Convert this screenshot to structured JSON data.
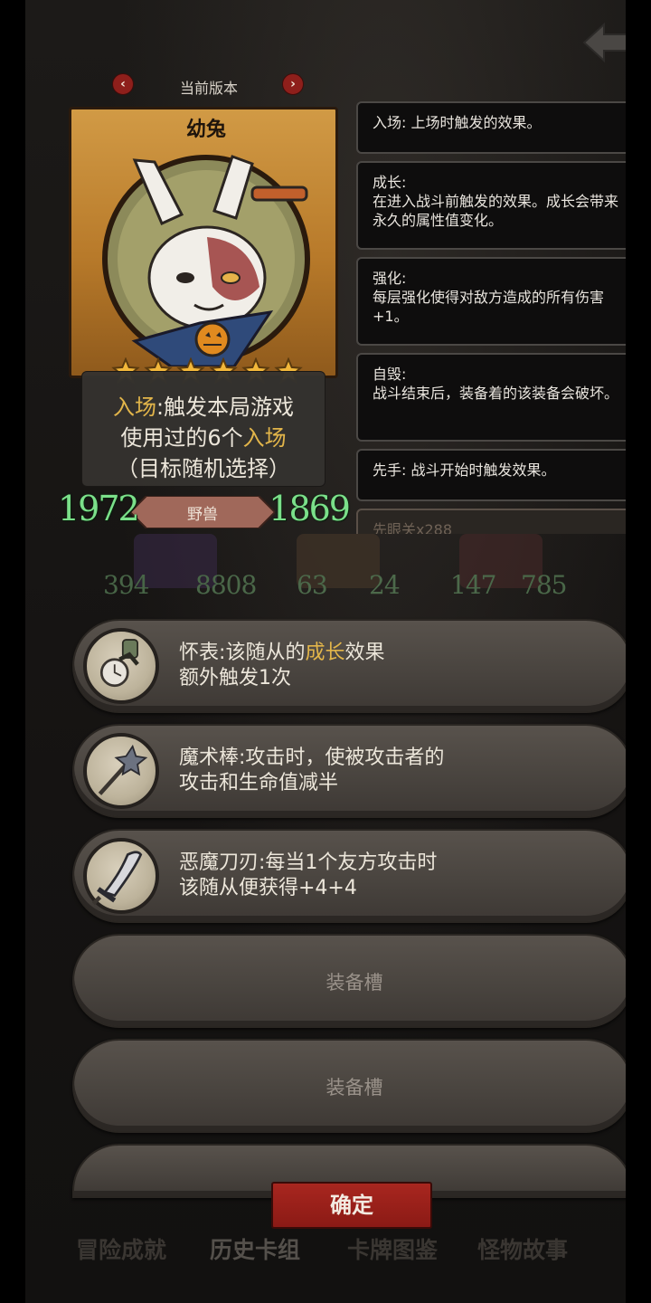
{
  "version": {
    "label": "当前版本",
    "prev_symbol": "‹",
    "next_symbol": "›"
  },
  "card": {
    "name": "幼兔",
    "stars": 6,
    "description": {
      "kw1": "入场",
      "line1_rest": ":触发本局游戏",
      "line2_prefix": "使用过的6个",
      "kw2": "入场",
      "line3": "（目标随机选择）"
    },
    "attack": "1972",
    "health": "1869",
    "tribe": "野兽"
  },
  "tooltips": [
    {
      "title": "入场: 上场时触发的效果。",
      "body": ""
    },
    {
      "title": "成长:",
      "body": "在进入战斗前触发的效果。成长会带来永久的属性值变化。"
    },
    {
      "title": "强化:",
      "body": "每层强化使得对敌方造成的所有伤害+1。"
    },
    {
      "title": "自毁:",
      "body": "战斗结束后，装备着的该装备会破坏。"
    },
    {
      "title": "先手: 战斗开始时触发效果。",
      "body": ""
    },
    {
      "title": "先眼关x288",
      "body": ""
    }
  ],
  "mini_cards": [
    {
      "attack": "394",
      "health": "8808"
    },
    {
      "attack": "63",
      "health": "24"
    },
    {
      "attack": "147",
      "health": "785"
    }
  ],
  "equipment": [
    {
      "icon": "pocket-watch-icon",
      "name": "怀表",
      "sep": ":",
      "pre": "该随从的",
      "kw": "成长",
      "post": "效果",
      "line2": "额外触发1次"
    },
    {
      "icon": "magic-wand-icon",
      "line1": "魔术棒:攻击时，使被攻击者的",
      "line2": "攻击和生命值减半"
    },
    {
      "icon": "demon-blade-icon",
      "line1": "恶魔刀刃:每当1个友方攻击时",
      "line2": "该随从便获得+4+4"
    }
  ],
  "slots": [
    "装备槽",
    "装备槽"
  ],
  "confirm_label": "确定",
  "tabs": [
    "冒险成就",
    "历史卡组",
    "卡牌图鉴",
    "怪物故事"
  ],
  "colors": {
    "keyword": "#e2b54a",
    "stat_green": "#7be08a",
    "confirm_red": "#8b1a15"
  }
}
